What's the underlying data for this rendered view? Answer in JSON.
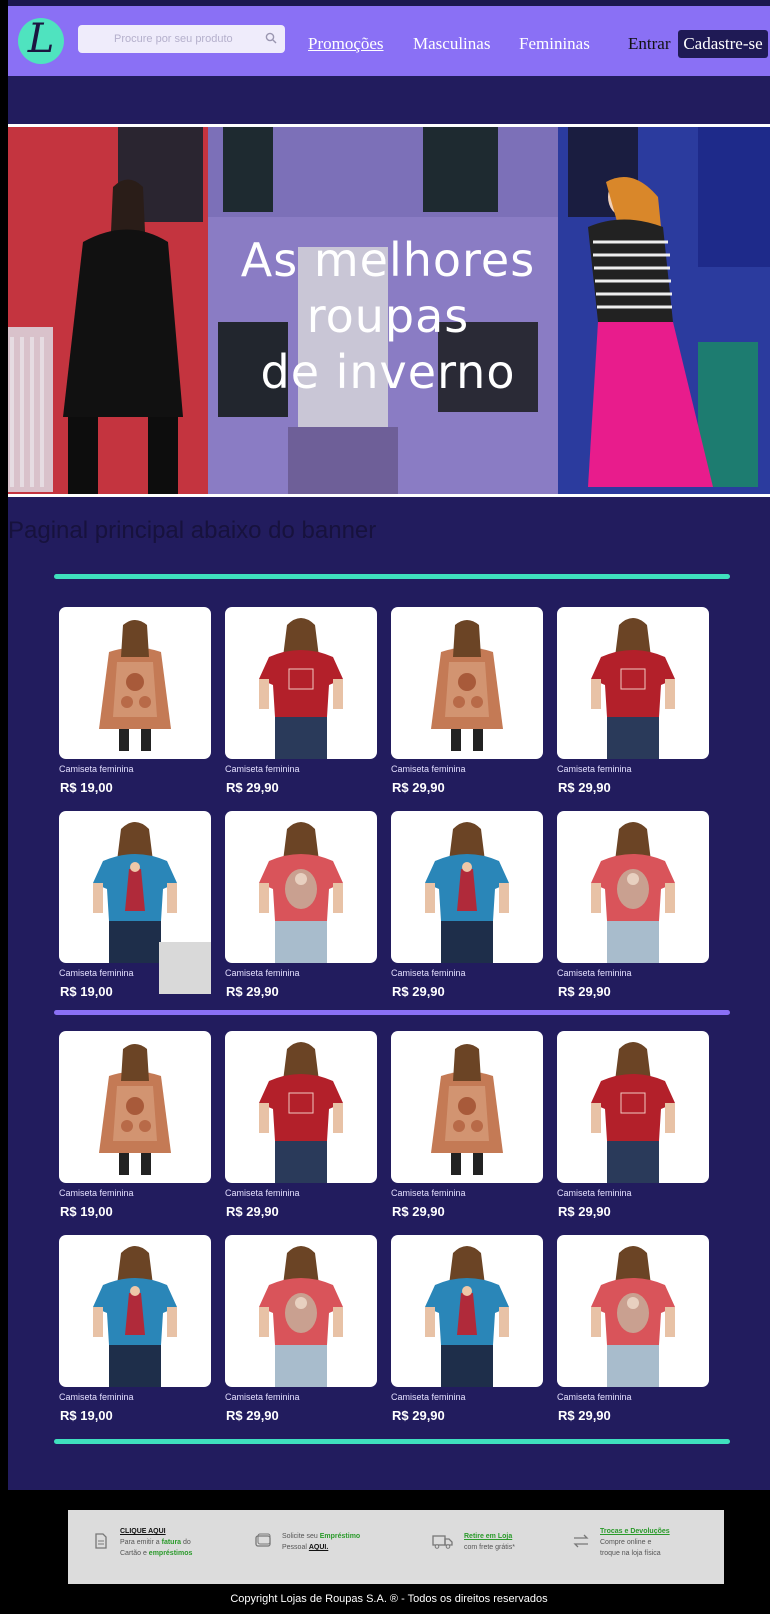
{
  "header": {
    "logo_letter": "L",
    "search_placeholder": "Procure por seu produto",
    "nav": [
      "Promoções",
      "Masculinas",
      "Femininas"
    ],
    "login_label": "Entrar",
    "signup_label": "Cadastre-se"
  },
  "banner": {
    "line1": "As melhores",
    "line2": "roupas",
    "line3": "de inverno"
  },
  "main": {
    "title": "Paginal principal abaixo do banner"
  },
  "colors": {
    "header_bg": "#8a70f5",
    "page_bg": "#221c5e",
    "accent_teal": "#3fe0be",
    "accent_purple": "#8a70f5"
  },
  "sections": [
    {
      "rows": [
        [
          {
            "name": "Camiseta feminina",
            "price": "R$ 19,00",
            "img": "dress"
          },
          {
            "name": "Camiseta feminina",
            "price": "R$ 29,90",
            "img": "red"
          },
          {
            "name": "Camiseta feminina",
            "price": "R$ 29,90",
            "img": "dress"
          },
          {
            "name": "Camiseta feminina",
            "price": "R$ 29,90",
            "img": "red"
          }
        ],
        [
          {
            "name": "Camiseta feminina",
            "price": "R$ 19,00",
            "img": "blue"
          },
          {
            "name": "Camiseta feminina",
            "price": "R$ 29,90",
            "img": "coral"
          },
          {
            "name": "Camiseta feminina",
            "price": "R$ 29,90",
            "img": "blue"
          },
          {
            "name": "Camiseta feminina",
            "price": "R$ 29,90",
            "img": "coral"
          }
        ]
      ]
    },
    {
      "rows": [
        [
          {
            "name": "Camiseta feminina",
            "price": "R$ 19,00",
            "img": "dress"
          },
          {
            "name": "Camiseta feminina",
            "price": "R$ 29,90",
            "img": "red"
          },
          {
            "name": "Camiseta feminina",
            "price": "R$ 29,90",
            "img": "dress"
          },
          {
            "name": "Camiseta feminina",
            "price": "R$ 29,90",
            "img": "red"
          }
        ],
        [
          {
            "name": "Camiseta feminina",
            "price": "R$ 19,00",
            "img": "blue"
          },
          {
            "name": "Camiseta feminina",
            "price": "R$ 29,90",
            "img": "coral"
          },
          {
            "name": "Camiseta feminina",
            "price": "R$ 29,90",
            "img": "blue"
          },
          {
            "name": "Camiseta feminina",
            "price": "R$ 29,90",
            "img": "coral"
          }
        ]
      ]
    }
  ],
  "footer": {
    "items": [
      {
        "icon": "document-icon",
        "title": "CLIQUE AQUI",
        "line1": "Para emitir a ",
        "hl1": "fatura",
        "line1b": " do",
        "line2": "Cartão e ",
        "hl2": "empréstimos"
      },
      {
        "icon": "card-icon",
        "line1": "Solicite seu ",
        "hl1": "Empréstimo",
        "line2": "Pessoal ",
        "hl2": "AQUI."
      },
      {
        "icon": "truck-icon",
        "title": "Retire em Loja",
        "line2": "com frete grátis*"
      },
      {
        "icon": "exchange-icon",
        "title": "Trocas e Devoluções",
        "line1": "Compre online e",
        "line2": "troque na loja física"
      }
    ],
    "copyright": "Copyright Lojas de Roupas S.A. ® - Todos os direitos reservados"
  }
}
